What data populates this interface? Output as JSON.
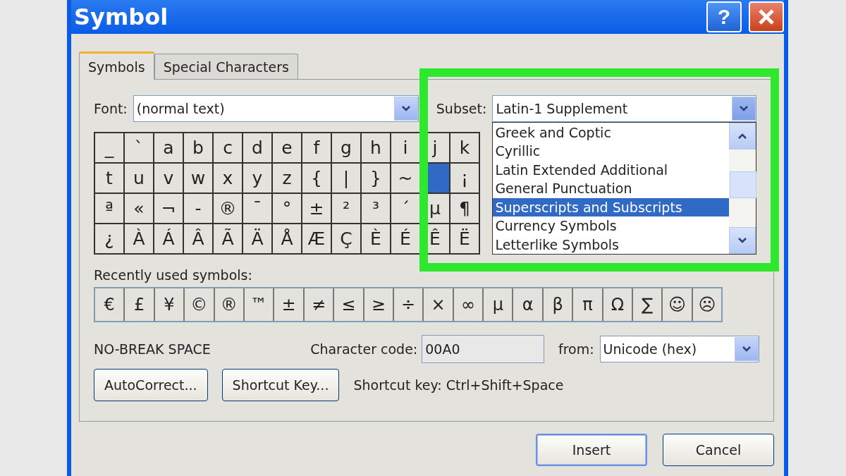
{
  "window": {
    "title": "Symbol",
    "help_label": "?"
  },
  "tabs": [
    {
      "label": "Symbols",
      "selected": true
    },
    {
      "label": "Special Characters",
      "selected": false
    }
  ],
  "font": {
    "label": "Font:",
    "value": "(normal text)"
  },
  "subset": {
    "label": "Subset:",
    "value": "Latin-1 Supplement",
    "expanded": true,
    "options": [
      {
        "label": "Greek and Coptic",
        "selected": false
      },
      {
        "label": "Cyrillic",
        "selected": false
      },
      {
        "label": "Latin Extended Additional",
        "selected": false
      },
      {
        "label": "General Punctuation",
        "selected": false
      },
      {
        "label": "Superscripts and Subscripts",
        "selected": true
      },
      {
        "label": "Currency Symbols",
        "selected": false
      },
      {
        "label": "Letterlike Symbols",
        "selected": false
      }
    ]
  },
  "symbol_grid": [
    [
      {
        "char": "_",
        "selected": false
      },
      {
        "char": "`",
        "selected": false
      },
      {
        "char": "a",
        "selected": false
      },
      {
        "char": "b",
        "selected": false
      },
      {
        "char": "c",
        "selected": false
      },
      {
        "char": "d",
        "selected": false
      },
      {
        "char": "e",
        "selected": false
      },
      {
        "char": "f",
        "selected": false
      },
      {
        "char": "g",
        "selected": false
      },
      {
        "char": "h",
        "selected": false
      },
      {
        "char": "i",
        "selected": false
      },
      {
        "char": "j",
        "selected": false
      },
      {
        "char": "k",
        "selected": false
      }
    ],
    [
      {
        "char": "t",
        "selected": false
      },
      {
        "char": "u",
        "selected": false
      },
      {
        "char": "v",
        "selected": false
      },
      {
        "char": "w",
        "selected": false
      },
      {
        "char": "x",
        "selected": false
      },
      {
        "char": "y",
        "selected": false
      },
      {
        "char": "z",
        "selected": false
      },
      {
        "char": "{",
        "selected": false
      },
      {
        "char": "|",
        "selected": false
      },
      {
        "char": "}",
        "selected": false
      },
      {
        "char": "~",
        "selected": false
      },
      {
        "selected": true
      },
      {
        "char": "¡",
        "selected": false
      }
    ],
    [
      {
        "char": "ª",
        "selected": false
      },
      {
        "char": "«",
        "selected": false
      },
      {
        "char": "¬",
        "selected": false
      },
      {
        "char": "-",
        "selected": false
      },
      {
        "char": "®",
        "selected": false
      },
      {
        "char": "¯",
        "selected": false
      },
      {
        "char": "°",
        "selected": false
      },
      {
        "char": "±",
        "selected": false
      },
      {
        "char": "²",
        "selected": false
      },
      {
        "char": "³",
        "selected": false
      },
      {
        "char": "´",
        "selected": false
      },
      {
        "char": "µ",
        "selected": false
      },
      {
        "char": "¶",
        "selected": false
      }
    ],
    [
      {
        "char": "¿",
        "selected": false
      },
      {
        "char": "À",
        "selected": false
      },
      {
        "char": "Á",
        "selected": false
      },
      {
        "char": "Â",
        "selected": false
      },
      {
        "char": "Ã",
        "selected": false
      },
      {
        "char": "Ä",
        "selected": false
      },
      {
        "char": "Å",
        "selected": false
      },
      {
        "char": "Æ",
        "selected": false
      },
      {
        "char": "Ç",
        "selected": false
      },
      {
        "char": "È",
        "selected": false
      },
      {
        "char": "É",
        "selected": false
      },
      {
        "char": "Ê",
        "selected": false
      },
      {
        "char": "Ë",
        "selected": false
      }
    ]
  ],
  "recent": {
    "label": "Recently used symbols:",
    "symbols": [
      "€",
      "£",
      "¥",
      "©",
      "®",
      "™",
      "±",
      "≠",
      "≤",
      "≥",
      "÷",
      "×",
      "∞",
      "μ",
      "α",
      "β",
      "π",
      "Ω",
      "∑",
      "☺",
      "☹"
    ]
  },
  "character_name": "NO-BREAK SPACE",
  "character_code": {
    "label": "Character code:",
    "value": "00A0"
  },
  "from": {
    "label": "from:",
    "value": "Unicode (hex)"
  },
  "actions": [
    {
      "label": "AutoCorrect..."
    },
    {
      "label": "Shortcut Key..."
    }
  ],
  "shortcut_text": "Shortcut key: Ctrl+Shift+Space",
  "footer_buttons": [
    {
      "label": "Insert",
      "default": true
    },
    {
      "label": "Cancel",
      "default": false
    }
  ],
  "highlight": {
    "shown": true
  }
}
